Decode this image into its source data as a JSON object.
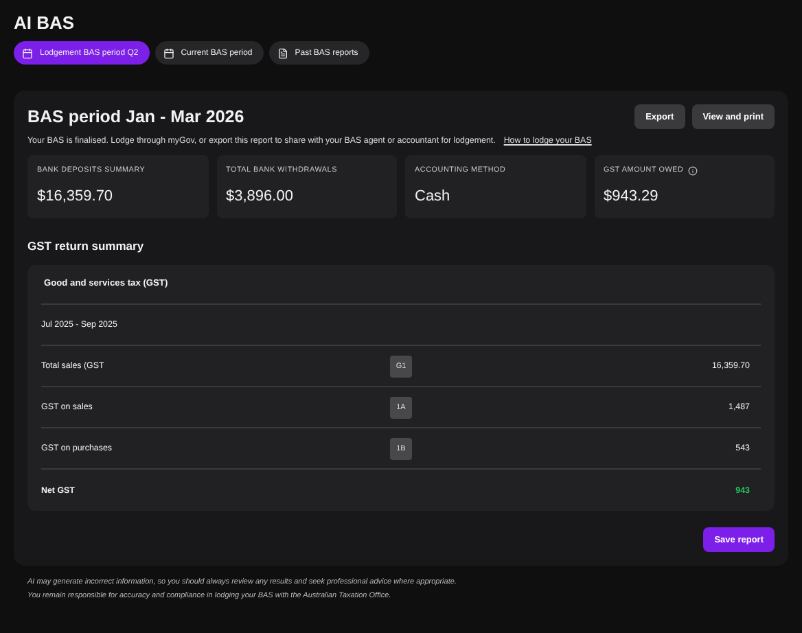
{
  "page_title": "AI BAS",
  "tabs": [
    {
      "label": "Lodgement BAS period Q2",
      "kind": "period",
      "selected": true
    },
    {
      "label": "Current BAS period",
      "kind": "period",
      "selected": false
    },
    {
      "label": "Past BAS reports",
      "kind": "reports",
      "selected": false
    }
  ],
  "report": {
    "title": "BAS period Jan - Mar 2026",
    "buttons": [
      "Export",
      "View and print"
    ],
    "message": "Your BAS is finalised. Lodge through myGov, or export this report to share with your BAS agent or accountant for lodgement.",
    "help_link": "How to lodge your BAS",
    "stats": [
      {
        "label": "BANK DEPOSITS SUMMARY",
        "value": "$16,359.70",
        "info": false
      },
      {
        "label": "TOTAL BANK WITHDRAWALS",
        "value": "$3,896.00",
        "info": false
      },
      {
        "label": "ACCOUNTING METHOD",
        "value": "Cash",
        "info": false
      },
      {
        "label": "GST AMOUNT OWED",
        "value": "$943.29",
        "info": true
      }
    ],
    "section_title": "GST return summary",
    "gst_table": {
      "title": "Good and services tax (GST)",
      "period": "Jul 2025 - Sep 2025",
      "rows": [
        {
          "kind": "line",
          "label": "Total sales (GST",
          "code": "G1",
          "value": "16,359.70"
        },
        {
          "kind": "line",
          "label": "GST on sales",
          "code": "1A",
          "value": "1,487"
        },
        {
          "kind": "line",
          "label": "GST on purchases",
          "code": "1B",
          "value": "543"
        },
        {
          "kind": "total",
          "label": "Net GST",
          "value": "943"
        }
      ]
    },
    "save_button": "Save report"
  },
  "disclaimer": [
    "AI may generate incorrect information, so you should always review any results and seek professional advice where appropriate.",
    "You remain responsible for accuracy and compliance in lodging your BAS with the Australian Taxation Office."
  ]
}
